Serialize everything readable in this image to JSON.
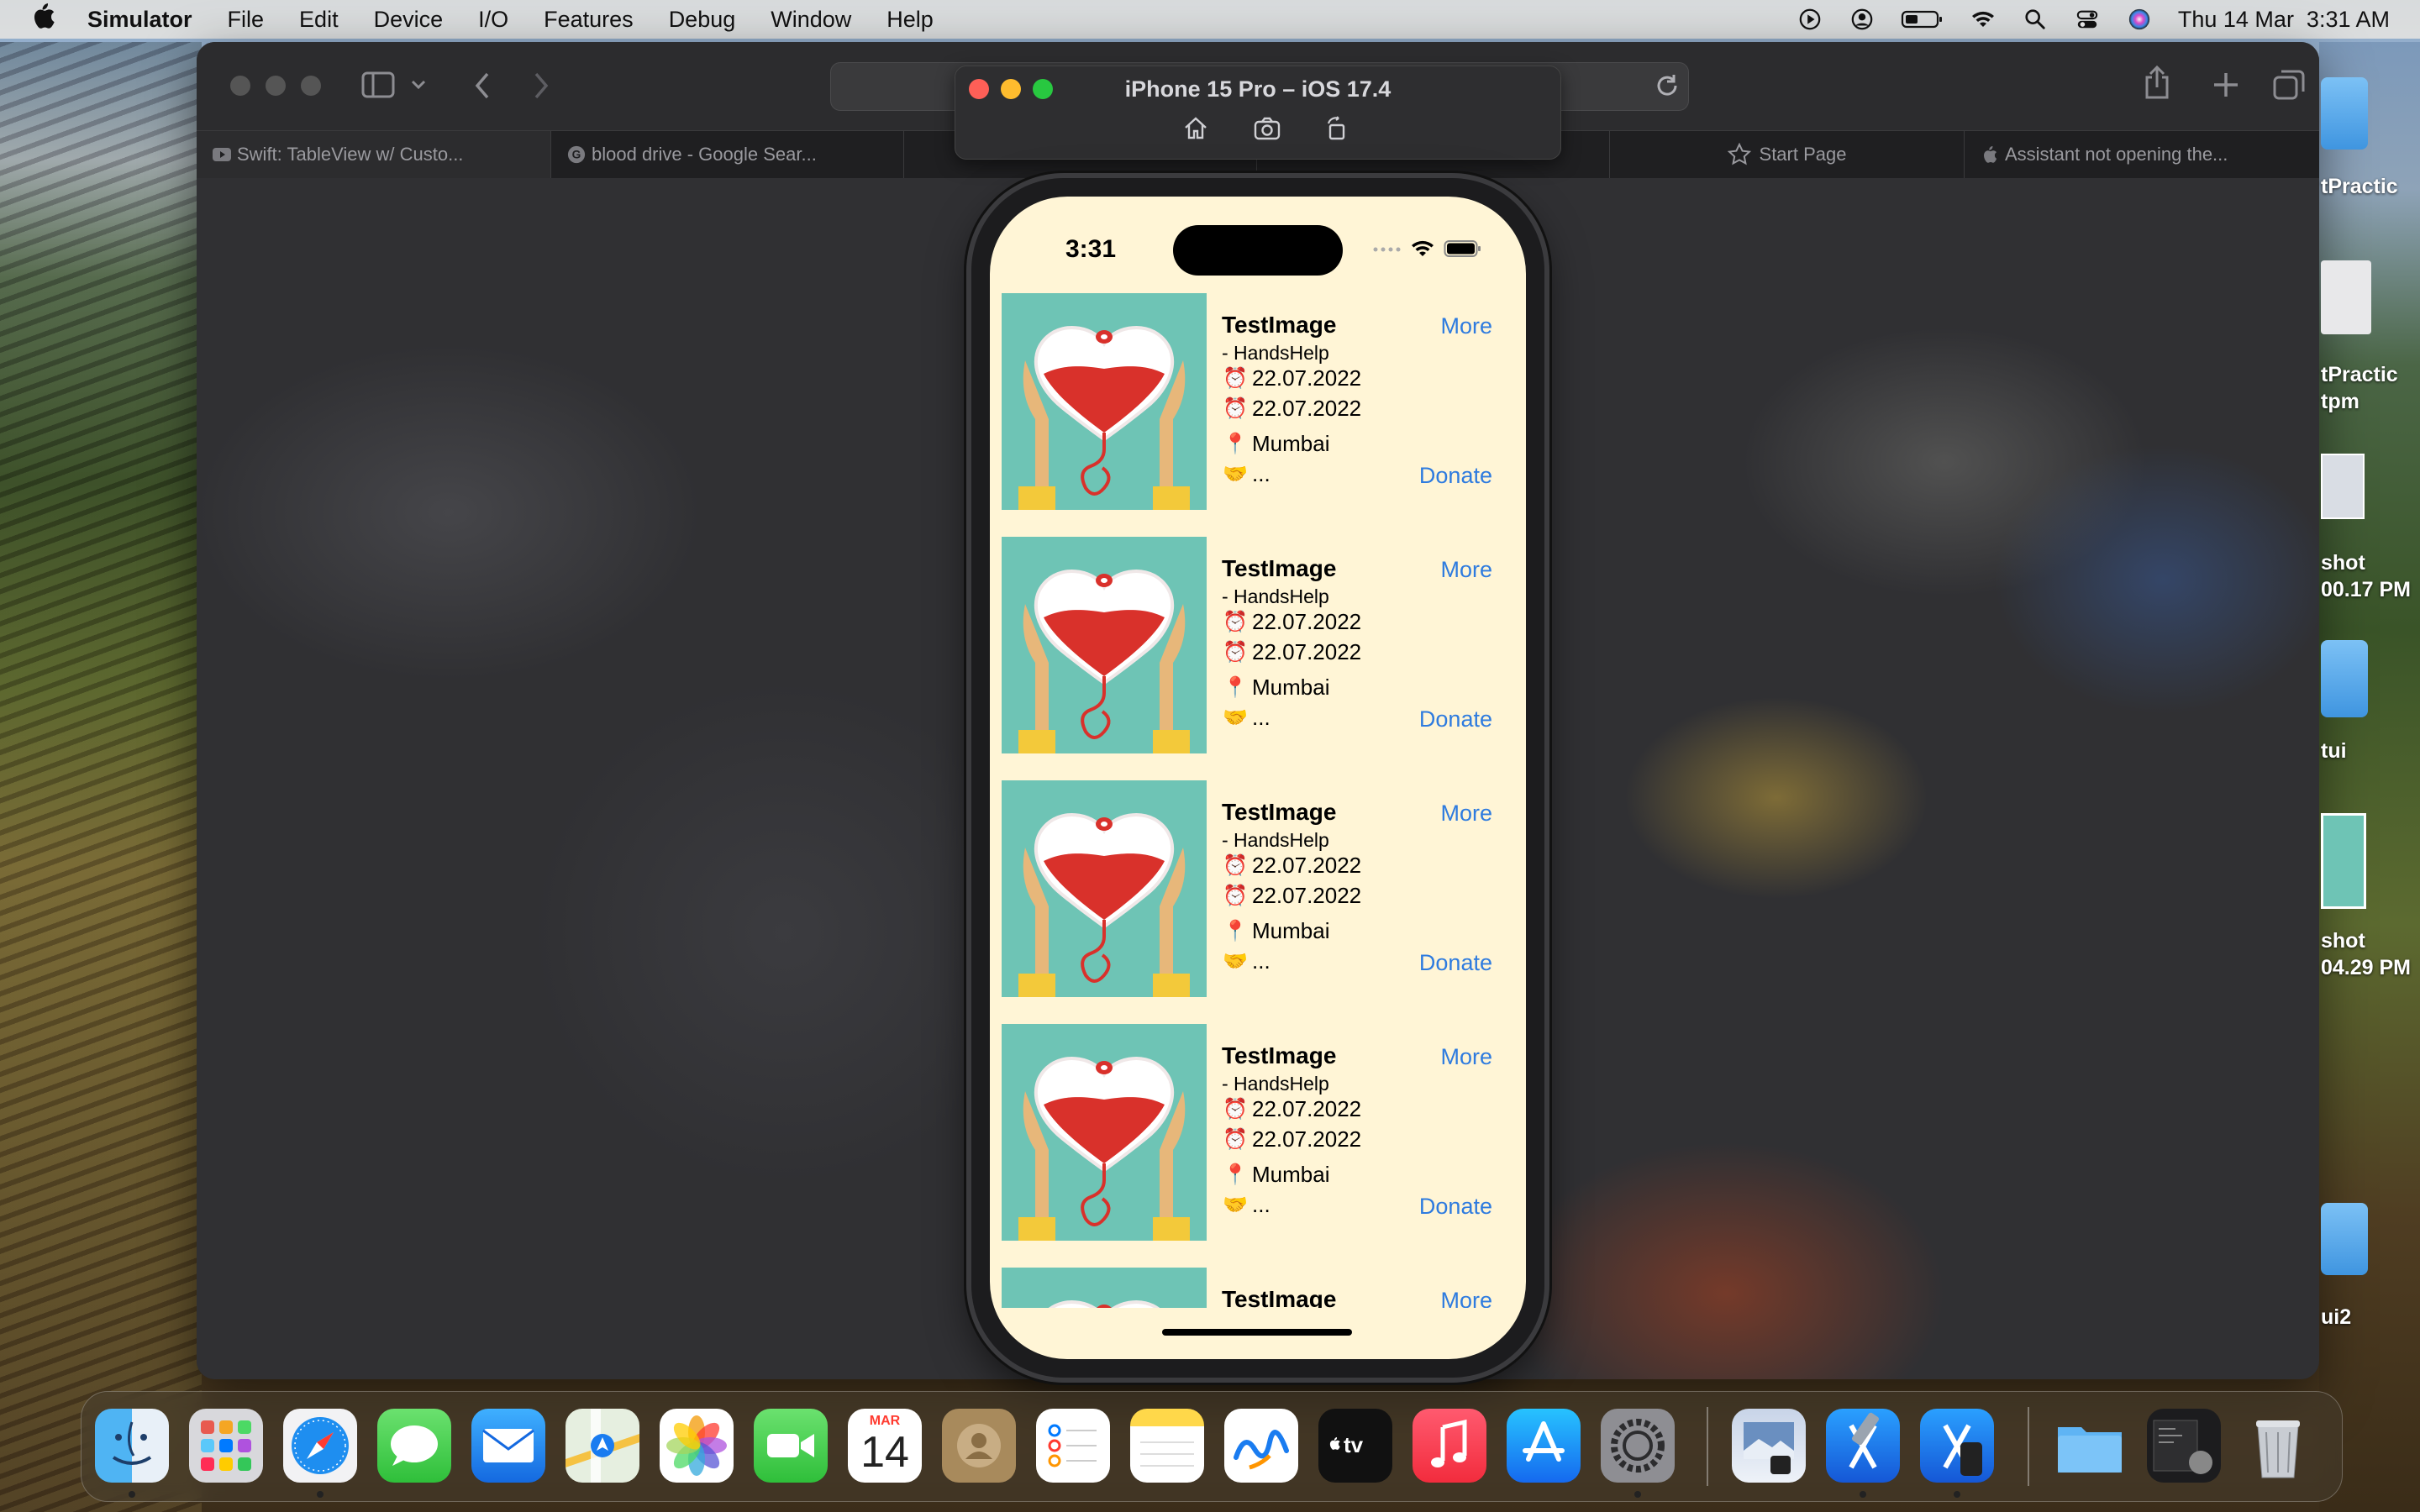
{
  "menubar": {
    "app_name": "Simulator",
    "items": [
      "File",
      "Edit",
      "Device",
      "I/O",
      "Features",
      "Debug",
      "Window",
      "Help"
    ],
    "clock": "Thu 14 Mar  3:31 AM"
  },
  "safari": {
    "tabs": [
      {
        "label": "Swift: TableView w/ Custo...",
        "icon": "youtube-icon"
      },
      {
        "label": "blood drive - Google Sear...",
        "icon": "google-icon"
      },
      {
        "label": "",
        "icon": "page-icon"
      },
      {
        "label": "",
        "icon": "page-icon"
      },
      {
        "label": "Start Page",
        "icon": "star-icon"
      },
      {
        "label": "Assistant not opening the...",
        "icon": "apple-icon"
      }
    ]
  },
  "simulator": {
    "title": "iPhone 15 Pro – iOS 17.4"
  },
  "phone": {
    "time": "3:31",
    "cells": [
      {
        "title": "TestImage",
        "org": "-   HandsHelp",
        "date1": "22.07.2022",
        "date2": "22.07.2022",
        "location": "Mumbai",
        "desc": "...",
        "more": "More",
        "donate": "Donate"
      },
      {
        "title": "TestImage",
        "org": "-   HandsHelp",
        "date1": "22.07.2022",
        "date2": "22.07.2022",
        "location": "Mumbai",
        "desc": "...",
        "more": "More",
        "donate": "Donate"
      },
      {
        "title": "TestImage",
        "org": "-   HandsHelp",
        "date1": "22.07.2022",
        "date2": "22.07.2022",
        "location": "Mumbai",
        "desc": "...",
        "more": "More",
        "donate": "Donate"
      },
      {
        "title": "TestImage",
        "org": "-   HandsHelp",
        "date1": "22.07.2022",
        "date2": "22.07.2022",
        "location": "Mumbai",
        "desc": "...",
        "more": "More",
        "donate": "Donate"
      },
      {
        "title": "TestImage",
        "more": "More"
      }
    ]
  },
  "desktop": {
    "labels": [
      "tPractic",
      "tPractic\ntpm",
      "shot\n00.17 PM",
      "tui",
      "shot\n04.29 PM",
      "ui2"
    ]
  },
  "dock": {
    "calendar_month": "MAR",
    "calendar_day": "14",
    "apps": [
      "finder",
      "launchpad",
      "safari",
      "messages",
      "mail",
      "maps",
      "photos",
      "facetime",
      "calendar",
      "contacts",
      "reminders",
      "notes",
      "freeform",
      "tv",
      "music",
      "app-store",
      "system-settings",
      "preview",
      "xcode",
      "instruments",
      "folder",
      "screenshot",
      "trash"
    ]
  },
  "colors": {
    "link": "#2e7bdf",
    "cell_background": "#fff5d6",
    "thumb_background": "#6ec4b5",
    "heart_red": "#d9312b"
  }
}
